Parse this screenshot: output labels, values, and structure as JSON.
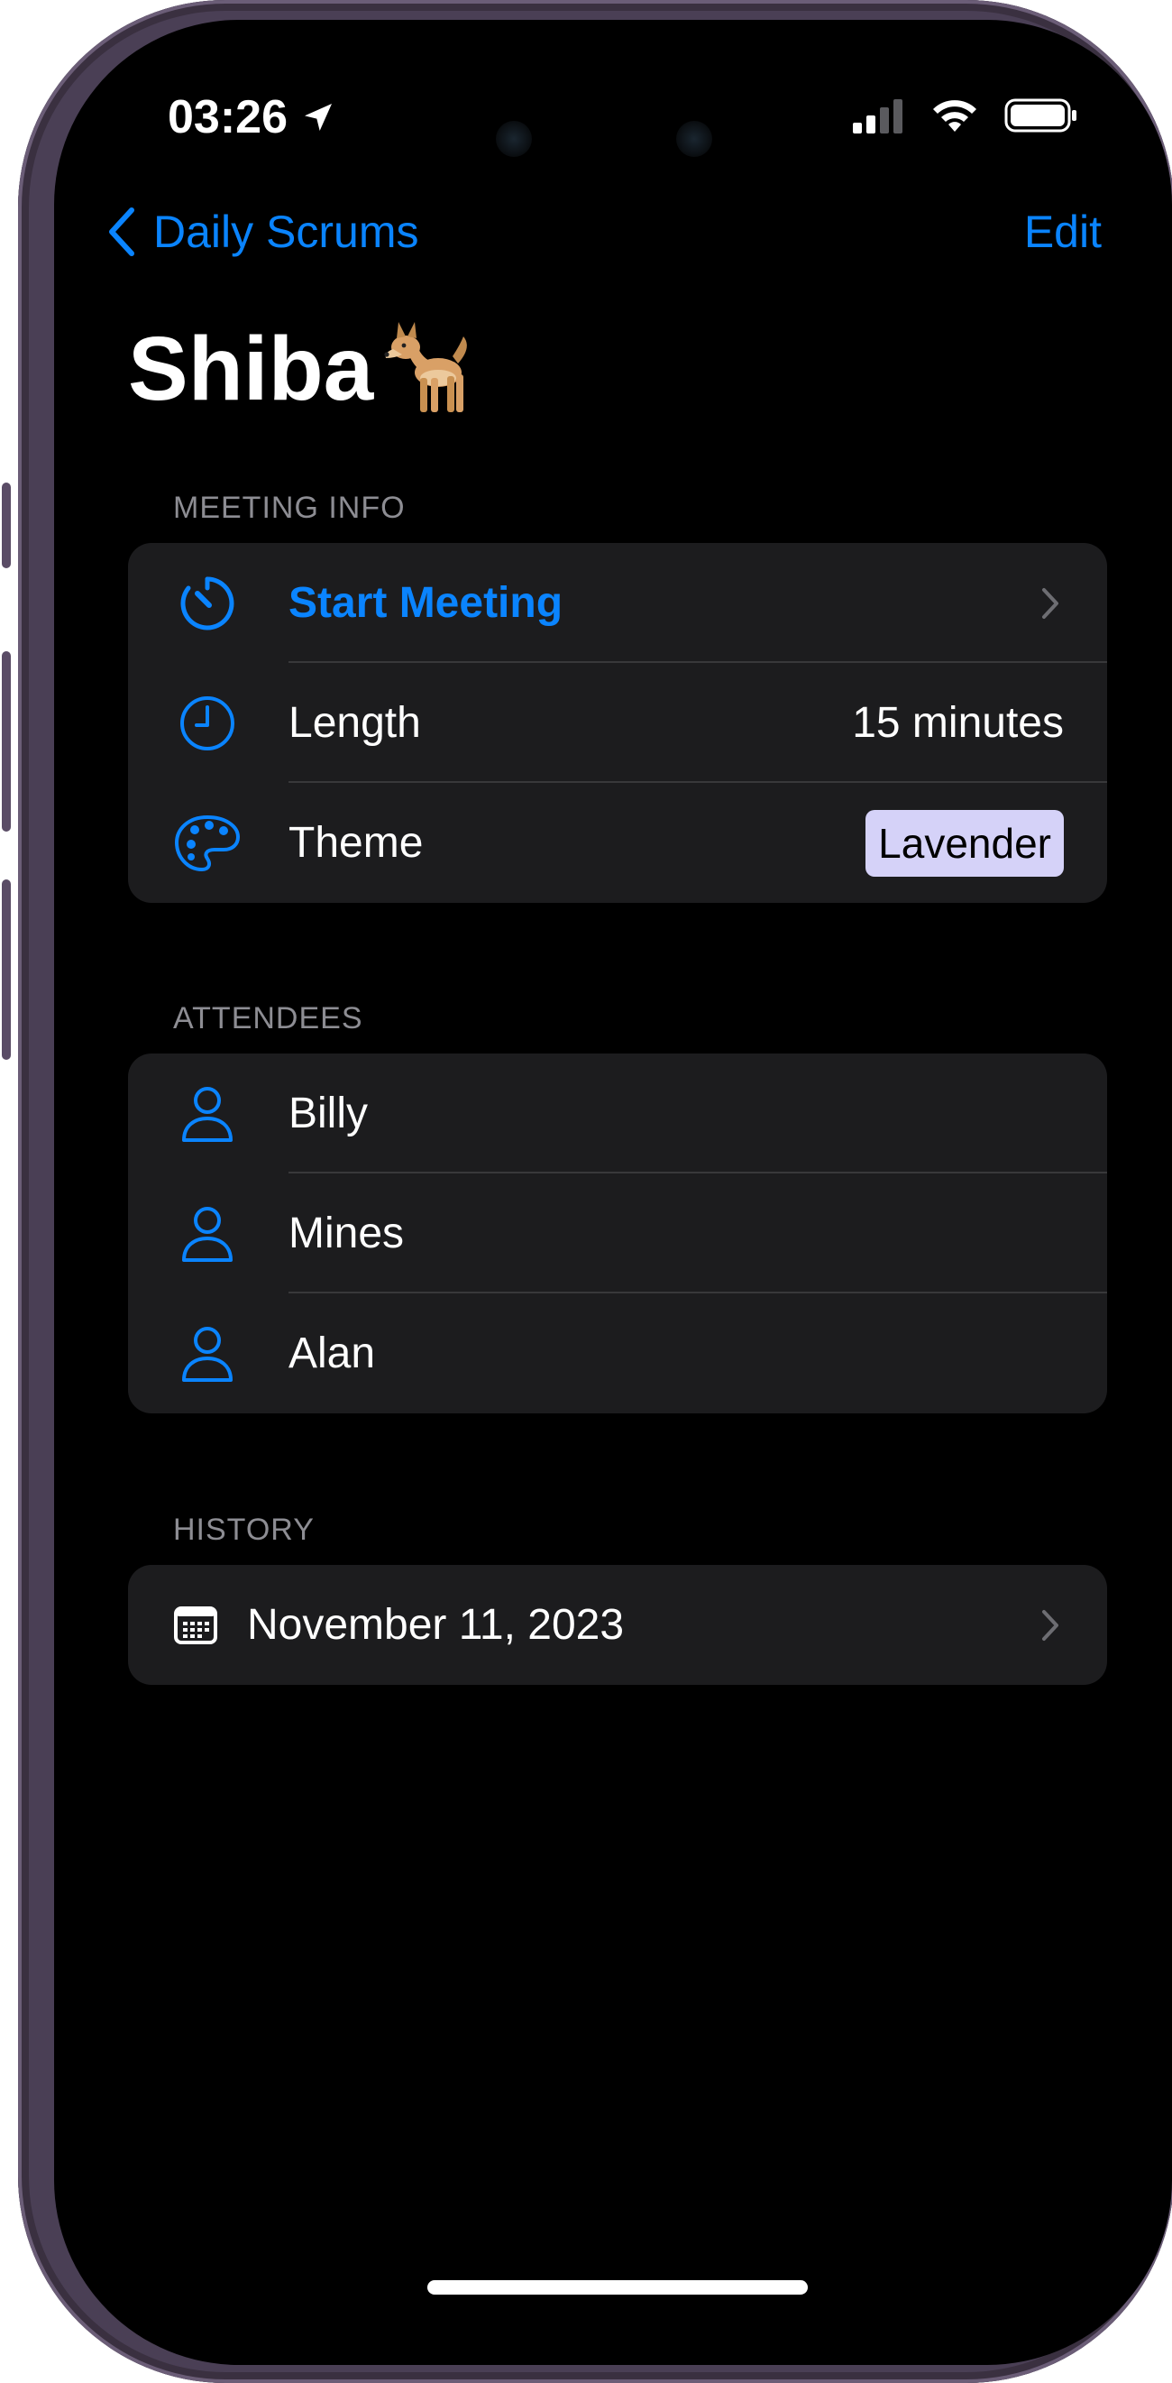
{
  "status_bar": {
    "time": "03:26",
    "icons": [
      "location-arrow-icon",
      "cellular-signal-icon",
      "wifi-icon",
      "battery-icon"
    ]
  },
  "nav": {
    "back_label": "Daily Scrums",
    "edit_label": "Edit"
  },
  "title": {
    "text": "Shiba",
    "emoji": "🐕"
  },
  "meeting_info": {
    "header": "MEETING INFO",
    "start_label": "Start Meeting",
    "length_label": "Length",
    "length_value": "15 minutes",
    "theme_label": "Theme",
    "theme_value": "Lavender"
  },
  "attendees": {
    "header": "ATTENDEES",
    "items": [
      {
        "name": "Billy"
      },
      {
        "name": "Mines"
      },
      {
        "name": "Alan"
      }
    ]
  },
  "history": {
    "header": "HISTORY",
    "items": [
      {
        "date": "November 11, 2023"
      }
    ]
  },
  "colors": {
    "accent": "#0a84ff",
    "background": "#000000",
    "group_background": "#1c1c1e",
    "theme_swatch": "#d5d2f8"
  }
}
